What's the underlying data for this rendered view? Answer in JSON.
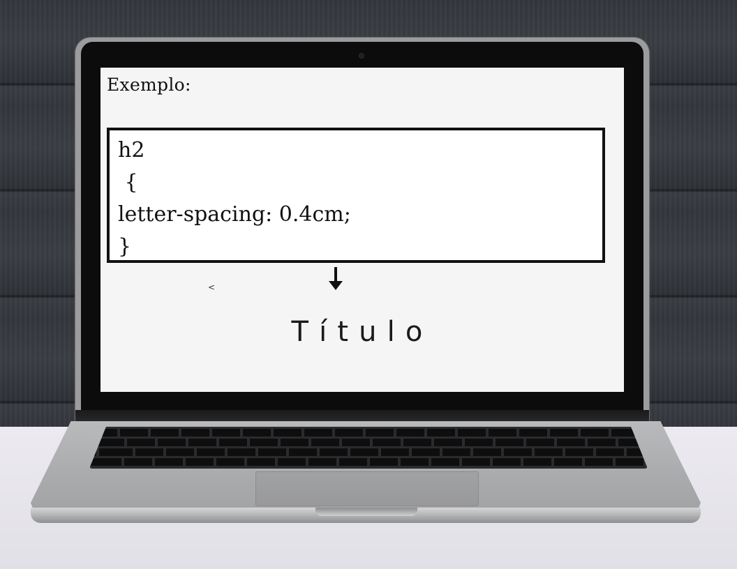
{
  "screen": {
    "label": "Exemplo:",
    "code_lines": [
      "h2",
      " {",
      "letter-spacing: 0.4cm;",
      "}"
    ],
    "small_mark": "<",
    "demo_title": "Título"
  },
  "colors": {
    "screen_bg": "#f5f5f5",
    "text": "#111111",
    "bezel": "#0c0c0d",
    "wall": "#34373d"
  },
  "icons": [
    "arrow-down-icon",
    "camera-icon"
  ]
}
